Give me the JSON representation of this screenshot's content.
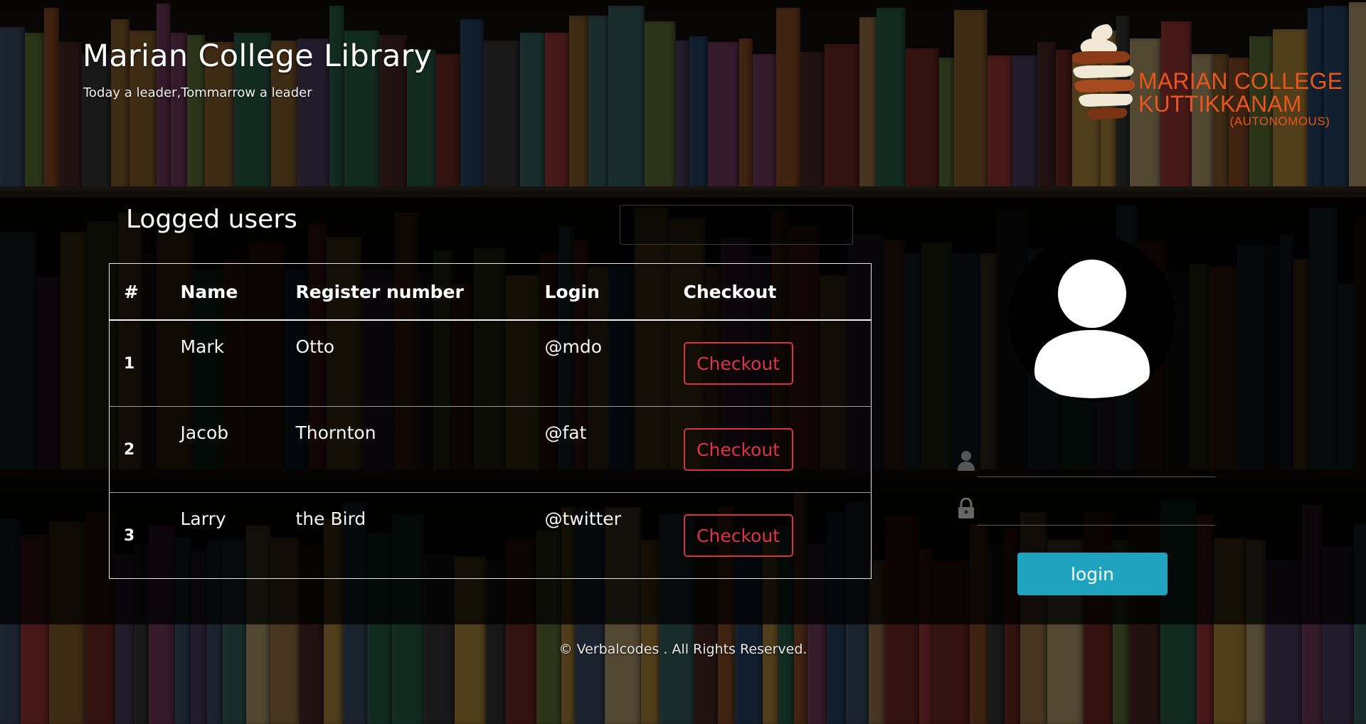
{
  "header": {
    "title": "Marian College Library",
    "tagline": "Today a leader,Tommarrow a leader"
  },
  "logo": {
    "line1": "MARIAN COLLEGE",
    "line2": "KUTTIKKANAM",
    "line3": "(AUTONOMOUS)",
    "color": "#e8561a"
  },
  "panel": {
    "title": "Logged users",
    "search_value": ""
  },
  "table": {
    "headers": [
      "#",
      "Name",
      "Register number",
      "Login",
      "Checkout"
    ],
    "rows": [
      {
        "num": "1",
        "name": "Mark",
        "register": "Otto",
        "login": "@mdo",
        "action": "Checkout"
      },
      {
        "num": "2",
        "name": "Jacob",
        "register": "Thornton",
        "login": "@fat",
        "action": "Checkout"
      },
      {
        "num": "3",
        "name": "Larry",
        "register": "the Bird",
        "login": "@twitter",
        "action": "Checkout"
      }
    ]
  },
  "login_form": {
    "username_icon": "user-icon",
    "password_icon": "lock-icon",
    "username_value": "",
    "password_value": "",
    "button_label": "login"
  },
  "footer": {
    "copyright": "© Verbalcodes . All Rights Reserved."
  },
  "colors": {
    "checkout_red": "#dc3545",
    "login_teal": "#1fa4bf"
  }
}
